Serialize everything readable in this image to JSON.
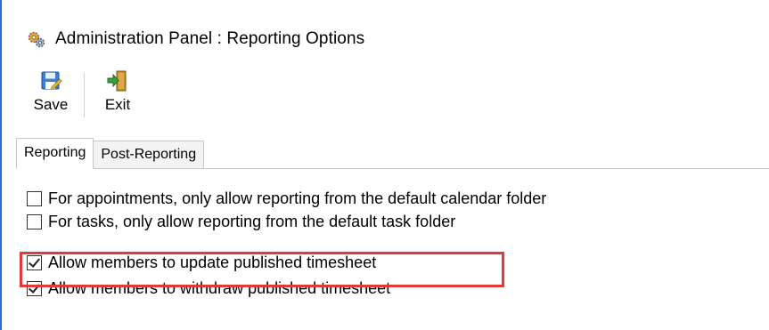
{
  "window": {
    "title": "Administration Panel : Reporting Options",
    "icon": "gears-icon"
  },
  "toolbar": {
    "buttons": [
      {
        "label": "Save",
        "icon": "save-icon"
      },
      {
        "label": "Exit",
        "icon": "exit-icon"
      }
    ]
  },
  "tabs": [
    {
      "label": "Reporting",
      "active": true
    },
    {
      "label": "Post-Reporting",
      "active": false
    }
  ],
  "options": [
    {
      "label": "For appointments, only allow reporting from the default calendar folder",
      "checked": false
    },
    {
      "label": "For tasks, only allow reporting from the default task folder",
      "checked": false
    },
    {
      "label": "Allow members to update published timesheet",
      "checked": true,
      "highlighted": true
    },
    {
      "label": "Allow members to withdraw published timesheet",
      "checked": true
    }
  ],
  "colors": {
    "highlight": "#e03a3a",
    "accent": "#2b6cc4"
  }
}
